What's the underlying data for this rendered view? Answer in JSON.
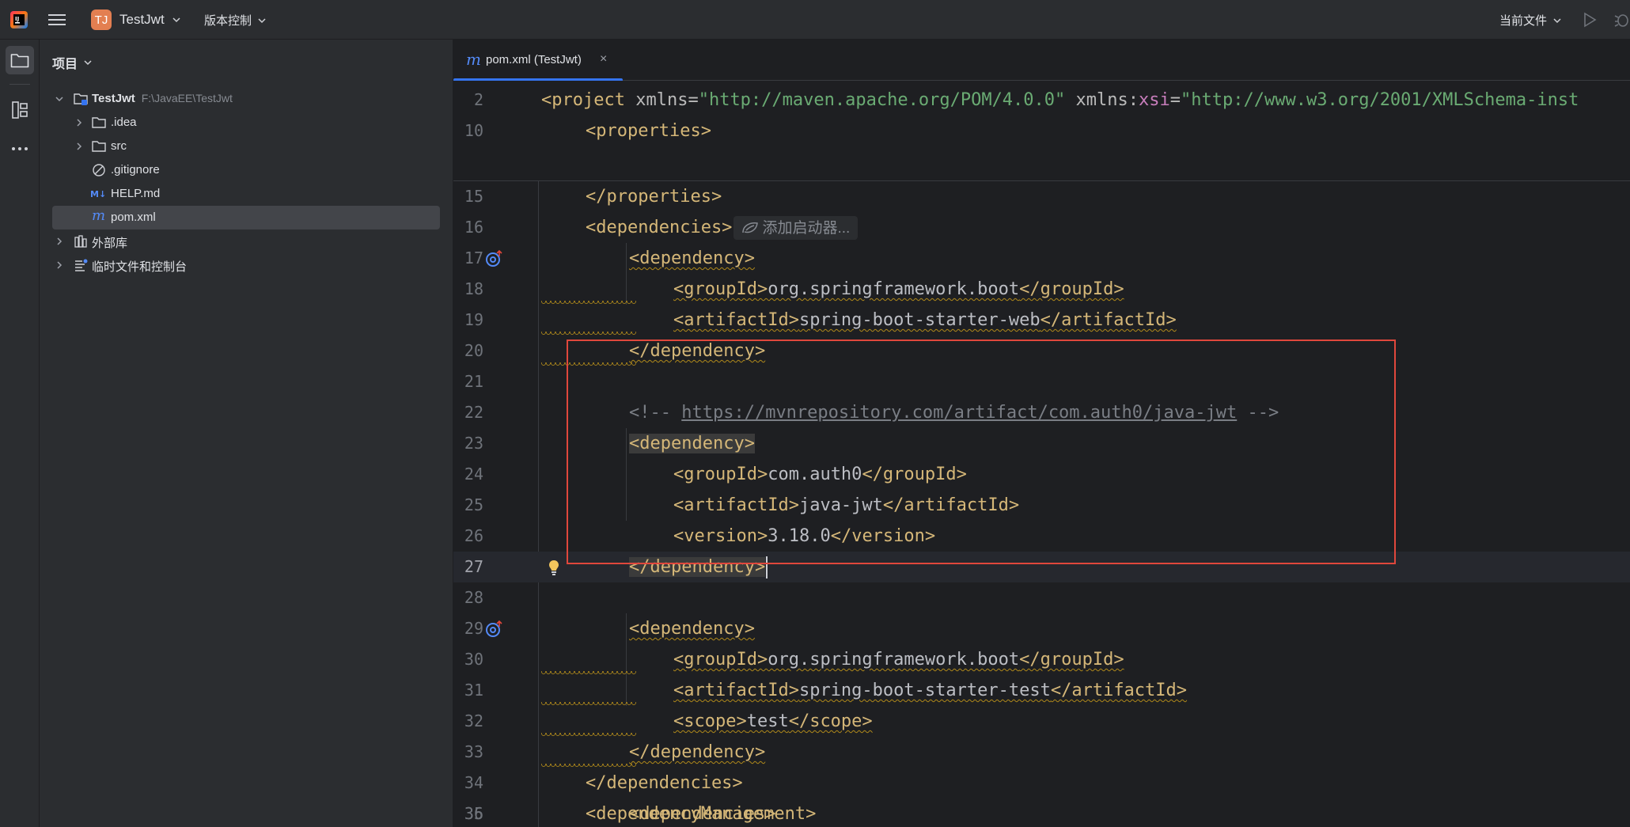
{
  "titlebar": {
    "project_badge": "TJ",
    "project_name": "TestJwt",
    "vcs_label": "版本控制",
    "run_config_label": "当前文件"
  },
  "project_panel": {
    "header": "项目",
    "tree": [
      {
        "label": "TestJwt",
        "path": "F:\\JavaEE\\TestJwt",
        "type": "module-folder",
        "expanded": true
      },
      {
        "label": ".idea",
        "type": "folder"
      },
      {
        "label": "src",
        "type": "folder"
      },
      {
        "label": ".gitignore",
        "type": "ignore-file"
      },
      {
        "label": "HELP.md",
        "type": "markdown-file"
      },
      {
        "label": "pom.xml",
        "type": "maven-file",
        "selected": true
      },
      {
        "label": "外部库",
        "type": "library"
      },
      {
        "label": "临时文件和控制台",
        "type": "scratches"
      }
    ]
  },
  "editor": {
    "tab": {
      "icon": "m",
      "label": "pom.xml (TestJwt)",
      "close": "×"
    },
    "inlay_hint": "添加启动器...",
    "lines": [
      {
        "n": "2",
        "text": "<project xmlns=\"http://maven.apache.org/POM/4.0.0\" xmlns:xsi=\"http://www.w3.org/2001/XMLSchema-inst"
      },
      {
        "n": "10",
        "text": "<properties>"
      },
      {
        "n": "15",
        "text": "</properties>"
      },
      {
        "n": "16",
        "text": "<dependencies>"
      },
      {
        "n": "17",
        "text": "<dependency>"
      },
      {
        "n": "18",
        "text": "<groupId>org.springframework.boot</groupId>"
      },
      {
        "n": "19",
        "text": "<artifactId>spring-boot-starter-web</artifactId>"
      },
      {
        "n": "20",
        "text": "</dependency>"
      },
      {
        "n": "21",
        "text": ""
      },
      {
        "n": "22",
        "text": "<!-- https://mvnrepository.com/artifact/com.auth0/java-jwt -->"
      },
      {
        "n": "23",
        "text": "<dependency>"
      },
      {
        "n": "24",
        "text": "<groupId>com.auth0</groupId>"
      },
      {
        "n": "25",
        "text": "<artifactId>java-jwt</artifactId>"
      },
      {
        "n": "26",
        "text": "<version>3.18.0</version>"
      },
      {
        "n": "27",
        "text": "</dependency>"
      },
      {
        "n": "28",
        "text": ""
      },
      {
        "n": "29",
        "text": "<dependency>"
      },
      {
        "n": "30",
        "text": "<groupId>org.springframework.boot</groupId>"
      },
      {
        "n": "31",
        "text": "<artifactId>spring-boot-starter-test</artifactId>"
      },
      {
        "n": "32",
        "text": "<scope>test</scope>"
      },
      {
        "n": "33",
        "text": "</dependency>"
      },
      {
        "n": "34",
        "text": "</dependencies>"
      },
      {
        "n": "35",
        "text": "<dependencyManagement>"
      },
      {
        "n": "36",
        "text": "<dependencies>"
      }
    ]
  },
  "colors": {
    "accent": "#3574f0",
    "tag": "#d5b778",
    "string": "#6aab73",
    "namespace": "#c77dbb",
    "comment": "#7a7e85",
    "annotation_box": "#e0473c",
    "warning_underline": "#b0891a"
  }
}
